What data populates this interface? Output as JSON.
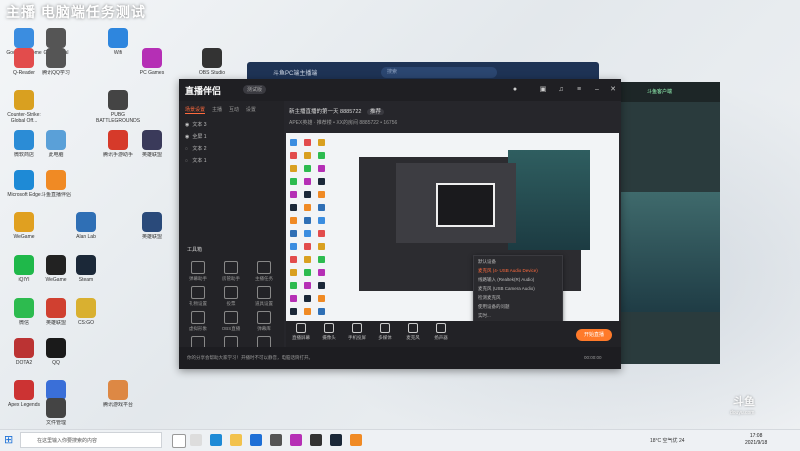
{
  "banner": {
    "text": "主播 电脑端任务测试"
  },
  "desktop_icons": [
    {
      "label": "Google Chrome",
      "color": "#3b8de0"
    },
    {
      "label": "Google Cal",
      "color": "#555"
    },
    {
      "label": "Wifi",
      "color": "#2e86de"
    },
    {
      "label": "Q-Reader",
      "color": "#e24c4c"
    },
    {
      "label": "腾讯QQ学习",
      "color": "#555"
    },
    {
      "label": "PC Games",
      "color": "#b52fb5"
    },
    {
      "label": "OBS Studio",
      "color": "#333"
    },
    {
      "label": "Counter-Strike: Global Off...",
      "color": "#d9a020"
    },
    {
      "label": "PUBG BATTLEGROUNDS",
      "color": "#444"
    },
    {
      "label": "微软商店",
      "color": "#2b8cd6"
    },
    {
      "label": "此电脑",
      "color": "#5aa0d8"
    },
    {
      "label": "腾讯手游助手",
      "color": "#d63a2a"
    },
    {
      "label": "英雄联盟",
      "color": "#3a3a5a"
    },
    {
      "label": "Microsoft Edge",
      "color": "#1e8ad6"
    },
    {
      "label": "斗鱼直播伴侣",
      "color": "#f08a24"
    },
    {
      "label": "WeGame",
      "color": "#e0a020"
    },
    {
      "label": "Alan Lab",
      "color": "#2f6fb5"
    },
    {
      "label": "英雄联盟",
      "color": "#2a4a7a"
    },
    {
      "label": "iQIYI",
      "color": "#1fb84a"
    },
    {
      "label": "WeGame",
      "color": "#222"
    },
    {
      "label": "Steam",
      "color": "#1b2838"
    },
    {
      "label": "微信",
      "color": "#2dbb4f"
    },
    {
      "label": "英雄联盟",
      "color": "#d04030"
    },
    {
      "label": "CS:GO",
      "color": "#d9b030"
    },
    {
      "label": "DOTA2",
      "color": "#b33"
    },
    {
      "label": "QQ",
      "color": "#1a1a1a"
    },
    {
      "label": "Media",
      "color": "#3a6fd8"
    },
    {
      "label": "Apex Legends",
      "color": "#c33"
    },
    {
      "label": "文件管理",
      "color": "#444"
    },
    {
      "label": "腾讯游戏平台",
      "color": "#d84"
    }
  ],
  "back_window": {
    "title": "斗鱼PC端主播端",
    "search": "搜索"
  },
  "right_window": {
    "title": "斗鱼客户端"
  },
  "app": {
    "logo": "直播伴侣",
    "version": "测试版",
    "left_tabs": [
      "场景设置",
      "主播",
      "互动",
      "设置"
    ],
    "scenes": [
      "文本 3",
      "全屏 1",
      "文本 2",
      "文本 1"
    ],
    "toolbox_title": "工具箱",
    "tools": [
      "弹幕助手",
      "房管助手",
      "主播任务",
      "礼物设置",
      "投票",
      "道具设置",
      "虚拟形象",
      "OBS直播",
      "弹幕库",
      "美颜",
      "直播间设置",
      "素材"
    ],
    "stream_title": "新主播直播的第一天 8885722",
    "stream_title_badge": "推荐",
    "stream_meta": "APEX英雄 · 推荐楼  •  XX的房间  8885722  •  16756",
    "dropdown": [
      {
        "label": "默认设备",
        "selected": false
      },
      {
        "label": "麦克风 (4- USB Audio Device)",
        "selected": true
      },
      {
        "label": "线路输入 (Realtek(R) Audio)",
        "selected": false
      },
      {
        "label": "麦克风 (USB Camera Audio)",
        "selected": false
      },
      {
        "label": "检测麦克风",
        "selected": false
      },
      {
        "label": "使用设备的问题",
        "selected": false
      },
      {
        "label": "实时...",
        "selected": false
      }
    ],
    "bottom_buttons": [
      "直播屏幕",
      "摄像头",
      "手机投屏",
      "多媒体",
      "麦克风",
      "扬声器"
    ],
    "start_live": "开始直播",
    "status_text": "你的分享会帮助大家学习！开播时不可以静音，电脑话筒打开。",
    "status_time": "00:00:00"
  },
  "taskbar": {
    "search_placeholder": "在这里输入你要搜索的内容",
    "tray_text": "18°C 空气优 24",
    "time": "17:08",
    "date": "2021/9/18"
  },
  "watermark": {
    "logo": "斗鱼",
    "sub": "douyu.com"
  }
}
